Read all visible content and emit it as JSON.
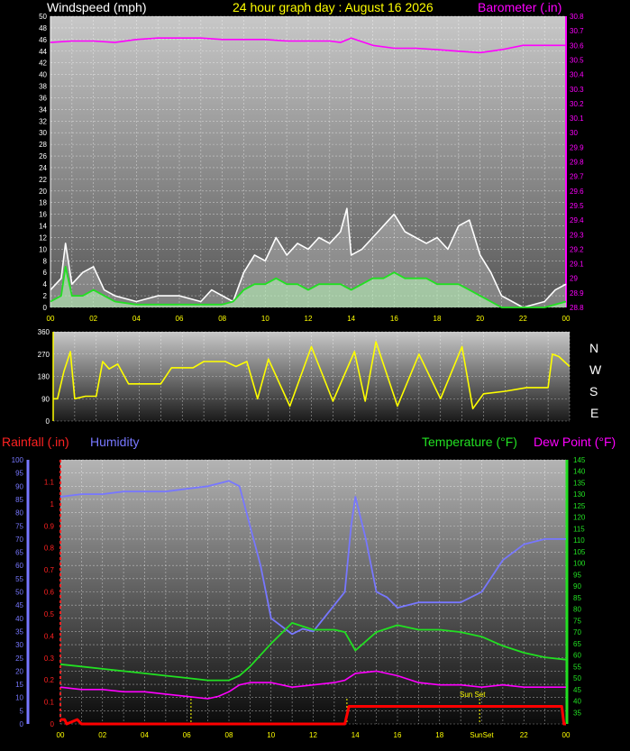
{
  "header": {
    "wind_title": "Windspeed (mph)",
    "day_title": "24 hour graph day : August 16 2026",
    "baro_title": "Barometer (.in)"
  },
  "legend": {
    "rainfall": "Rainfall (.in)",
    "humidity": "Humidity",
    "temperature": "Temperature (°F)",
    "dewpoint": "Dew Point (°F)",
    "sunset": "Sun Set",
    "sunrise_tick": "SunSet"
  },
  "compass": [
    "N",
    "W",
    "S",
    "E",
    "N"
  ],
  "colors": {
    "wind_gust": "#ffffff",
    "wind_avg": "#22e022",
    "barometer": "#ff00ff",
    "direction": "#ffff00",
    "rainfall": "#ff0000",
    "humidity": "#7777ff",
    "temperature": "#22e022",
    "dewpoint": "#ff00ff",
    "sun_marker": "#ffff00"
  },
  "chart_data": [
    {
      "type": "line",
      "title": "Windspeed (mph)",
      "x_ticks": [
        "00",
        "02",
        "04",
        "06",
        "08",
        "10",
        "12",
        "14",
        "16",
        "18",
        "20",
        "22",
        "00"
      ],
      "xlim": [
        0,
        24
      ],
      "ylim_left": [
        0,
        50
      ],
      "left_ticks": [
        0,
        2,
        4,
        6,
        8,
        10,
        12,
        14,
        16,
        18,
        20,
        22,
        24,
        26,
        28,
        30,
        32,
        34,
        36,
        38,
        40,
        42,
        44,
        46,
        48,
        50
      ],
      "ylim_right": [
        28.8,
        30.8
      ],
      "right_ticks": [
        "28.8",
        "28.9",
        "29",
        "29.1",
        "29.2",
        "29.3",
        "29.4",
        "29.5",
        "29.6",
        "29.7",
        "29.8",
        "29.9",
        "30",
        "30.1",
        "30.2",
        "30.3",
        "30.4",
        "30.5",
        "30.6",
        "30.7",
        "30.8"
      ],
      "series": [
        {
          "name": "Wind gust",
          "axis": "left",
          "hours": [
            0,
            0.5,
            0.7,
            1,
            1.5,
            2,
            2.5,
            3,
            4,
            5,
            6,
            7,
            7.5,
            8,
            8.5,
            9,
            9.5,
            10,
            10.5,
            11,
            11.5,
            12,
            12.5,
            13,
            13.5,
            13.8,
            14,
            14.5,
            15,
            15.5,
            16,
            16.5,
            17,
            17.5,
            18,
            18.5,
            19,
            19.5,
            20,
            20.5,
            21,
            22,
            23,
            23.5,
            24
          ],
          "values": [
            3,
            5,
            11,
            4,
            6,
            7,
            3,
            2,
            1,
            2,
            2,
            1,
            3,
            2,
            1,
            6,
            9,
            8,
            12,
            9,
            11,
            10,
            12,
            11,
            13,
            17,
            9,
            10,
            12,
            14,
            16,
            13,
            12,
            11,
            12,
            10,
            14,
            15,
            9,
            6,
            2,
            0,
            1,
            3,
            4
          ]
        },
        {
          "name": "Wind average",
          "axis": "left",
          "hours": [
            0,
            0.5,
            0.7,
            1,
            1.5,
            2,
            3,
            4,
            5,
            6,
            7,
            8,
            8.5,
            9,
            9.5,
            10,
            10.5,
            11,
            11.5,
            12,
            12.5,
            13,
            13.5,
            14,
            14.5,
            15,
            15.5,
            16,
            16.5,
            17,
            17.5,
            18,
            18.5,
            19,
            19.5,
            20,
            20.5,
            21,
            22,
            23,
            24
          ],
          "values": [
            1,
            2,
            7,
            2,
            2,
            3,
            1,
            0.5,
            0.5,
            0.5,
            0.5,
            0.5,
            1,
            3,
            4,
            4,
            5,
            4,
            4,
            3,
            4,
            4,
            4,
            3,
            4,
            5,
            5,
            6,
            5,
            5,
            5,
            4,
            4,
            4,
            3,
            2,
            1,
            0,
            0,
            0,
            1
          ]
        },
        {
          "name": "Barometer",
          "axis": "right",
          "hours": [
            0,
            1,
            2,
            3,
            4,
            5,
            6,
            7,
            8,
            9,
            10,
            11,
            12,
            13,
            13.5,
            14,
            15,
            16,
            17,
            18,
            19,
            20,
            21,
            22,
            23,
            24
          ],
          "values": [
            30.62,
            30.63,
            30.63,
            30.62,
            30.64,
            30.65,
            30.65,
            30.65,
            30.64,
            30.64,
            30.64,
            30.63,
            30.63,
            30.63,
            30.62,
            30.65,
            30.6,
            30.58,
            30.58,
            30.57,
            30.56,
            30.55,
            30.57,
            30.6,
            30.6,
            30.6
          ]
        }
      ]
    },
    {
      "type": "line",
      "title": "Wind direction",
      "xlim": [
        0,
        24
      ],
      "ylim": [
        0,
        360
      ],
      "y_ticks": [
        0,
        90,
        180,
        270,
        360
      ],
      "series": [
        {
          "name": "Direction",
          "hours": [
            0,
            0.2,
            0.5,
            0.8,
            1,
            1.5,
            2,
            2.3,
            2.6,
            3,
            3.5,
            4,
            5,
            5.5,
            6,
            6.5,
            7,
            7.5,
            8,
            8.5,
            9,
            9.5,
            10,
            11,
            12,
            13,
            14,
            14.5,
            15,
            16,
            17,
            18,
            19,
            19.5,
            20,
            21,
            22,
            23,
            23.2,
            23.5,
            24
          ],
          "values": [
            90,
            90,
            200,
            280,
            90,
            100,
            100,
            240,
            210,
            230,
            150,
            150,
            150,
            215,
            215,
            215,
            240,
            240,
            240,
            220,
            240,
            90,
            250,
            60,
            300,
            80,
            280,
            80,
            320,
            60,
            270,
            90,
            300,
            50,
            110,
            120,
            135,
            135,
            270,
            260,
            220
          ]
        }
      ]
    },
    {
      "type": "line",
      "title": "",
      "x_ticks": [
        "00",
        "02",
        "04",
        "06",
        "08",
        "10",
        "12",
        "14",
        "16",
        "18",
        "SunSet",
        "22",
        "00"
      ],
      "xlim": [
        0,
        24
      ],
      "ylim_humidity": [
        0,
        100
      ],
      "humidity_ticks": [
        0,
        5,
        10,
        15,
        20,
        25,
        30,
        35,
        40,
        45,
        50,
        55,
        60,
        65,
        70,
        75,
        80,
        85,
        90,
        95,
        100
      ],
      "ylim_rain": [
        0,
        1.2
      ],
      "rain_ticks": [
        "0",
        "0.1",
        "0.2",
        "0.3",
        "0.4",
        "0.5",
        "0.6",
        "0.7",
        "0.8",
        "0.9",
        "1",
        "1.1"
      ],
      "ylim_temp": [
        30,
        145
      ],
      "temp_ticks": [
        35,
        40,
        45,
        50,
        55,
        60,
        65,
        70,
        75,
        80,
        85,
        90,
        95,
        100,
        105,
        110,
        115,
        120,
        125,
        130,
        135,
        140,
        145
      ],
      "annotation": "Sun Set",
      "sun_marker_hours": [
        6.2,
        13.6,
        19.9
      ],
      "series": [
        {
          "name": "Rainfall",
          "axis": "rain",
          "hours": [
            0,
            0.2,
            0.3,
            0.8,
            1,
            13.5,
            13.7,
            14,
            20,
            23.8,
            23.9,
            24
          ],
          "values": [
            0.02,
            0.02,
            0,
            0.02,
            0,
            0,
            0.08,
            0.08,
            0.08,
            0.08,
            0,
            0
          ]
        },
        {
          "name": "Humidity",
          "axis": "humidity",
          "hours": [
            0,
            1,
            2,
            3,
            4,
            5,
            6,
            7,
            7.5,
            8,
            8.5,
            9,
            9.5,
            10,
            11,
            11.5,
            12,
            12.5,
            13,
            13.5,
            13.8,
            14,
            14.5,
            15,
            15.5,
            16,
            17,
            18,
            19,
            20,
            21,
            22,
            23,
            24
          ],
          "values": [
            86,
            87,
            87,
            88,
            88,
            88,
            89,
            90,
            91,
            92,
            90,
            75,
            60,
            40,
            34,
            36,
            35,
            40,
            45,
            50,
            75,
            86,
            70,
            50,
            48,
            44,
            46,
            46,
            46,
            50,
            62,
            68,
            70,
            70
          ]
        },
        {
          "name": "Temperature",
          "axis": "temp",
          "hours": [
            0,
            1,
            2,
            3,
            4,
            5,
            6,
            7,
            8,
            8.5,
            9,
            10,
            11,
            12,
            13,
            13.5,
            14,
            15,
            16,
            17,
            18,
            19,
            20,
            21,
            22,
            23,
            24
          ],
          "values": [
            56,
            55,
            54,
            53,
            52,
            51,
            50,
            49,
            49,
            51,
            55,
            65,
            74,
            71,
            71,
            70,
            62,
            70,
            73,
            71,
            71,
            70,
            68,
            64,
            61,
            59,
            58
          ]
        },
        {
          "name": "Dew Point",
          "axis": "temp",
          "hours": [
            0,
            1,
            2,
            3,
            4,
            5,
            6,
            7,
            7.5,
            8,
            8.5,
            9,
            10,
            11,
            12,
            13,
            13.5,
            14,
            15,
            16,
            17,
            18,
            19,
            20,
            21,
            22,
            23,
            24
          ],
          "values": [
            46,
            45,
            45,
            44,
            44,
            43,
            42,
            41,
            42,
            44,
            47,
            48,
            48,
            46,
            47,
            48,
            49,
            52,
            53,
            51,
            48,
            47,
            47,
            46,
            47,
            46,
            46,
            46
          ]
        }
      ]
    }
  ]
}
